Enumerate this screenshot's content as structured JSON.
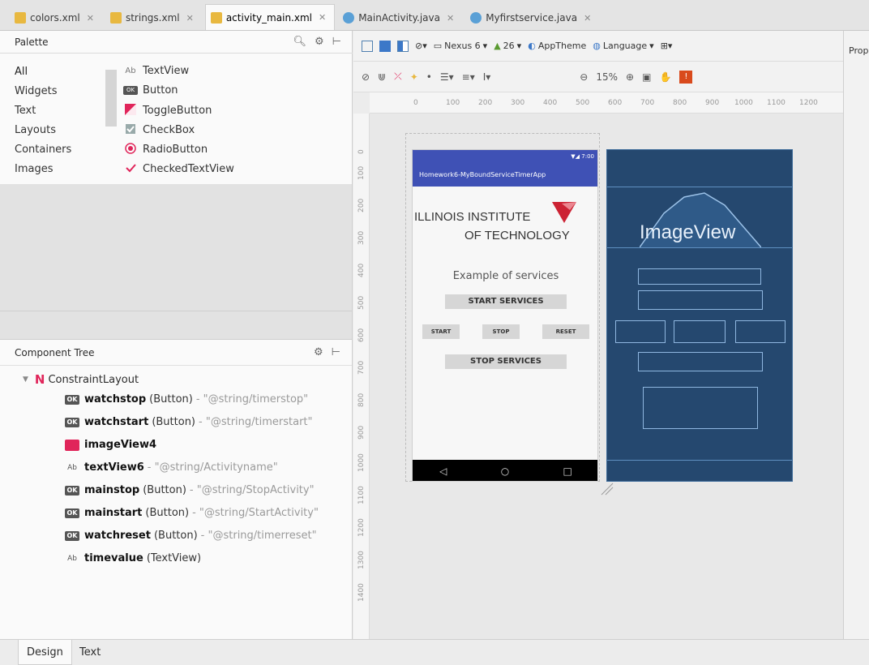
{
  "tabs": [
    {
      "label": "colors.xml",
      "kind": "xml",
      "active": false
    },
    {
      "label": "strings.xml",
      "kind": "xml",
      "active": false
    },
    {
      "label": "activity_main.xml",
      "kind": "xml",
      "active": true
    },
    {
      "label": "MainActivity.java",
      "kind": "java",
      "active": false
    },
    {
      "label": "Myfirstservice.java",
      "kind": "java",
      "active": false
    }
  ],
  "palette": {
    "title": "Palette",
    "categories": [
      "All",
      "Widgets",
      "Text",
      "Layouts",
      "Containers",
      "Images"
    ],
    "items": [
      {
        "icon": "Ab",
        "label": "TextView"
      },
      {
        "icon": "OK",
        "label": "Button"
      },
      {
        "icon": "toggle-icon",
        "label": "ToggleButton"
      },
      {
        "icon": "checkbox-icon",
        "label": "CheckBox"
      },
      {
        "icon": "radio-icon",
        "label": "RadioButton"
      },
      {
        "icon": "check-icon",
        "label": "CheckedTextView"
      }
    ]
  },
  "tree": {
    "title": "Component Tree",
    "root": "ConstraintLayout",
    "items": [
      {
        "icon": "OK",
        "name": "watchstop",
        "type": "(Button)",
        "str": "- \"@string/timerstop\""
      },
      {
        "icon": "OK",
        "name": "watchstart",
        "type": "(Button)",
        "str": "- \"@string/timerstart\""
      },
      {
        "icon": "image",
        "name": "imageView4",
        "type": "",
        "str": ""
      },
      {
        "icon": "Ab",
        "name": "textView6",
        "type": "",
        "str": "- \"@string/Activityname\""
      },
      {
        "icon": "OK",
        "name": "mainstop",
        "type": "(Button)",
        "str": "- \"@string/StopActivity\""
      },
      {
        "icon": "OK",
        "name": "mainstart",
        "type": "(Button)",
        "str": "- \"@string/StartActivity\""
      },
      {
        "icon": "OK",
        "name": "watchreset",
        "type": "(Button)",
        "str": "- \"@string/timerreset\""
      },
      {
        "icon": "Ab",
        "name": "timevalue",
        "type": "(TextView)",
        "str": ""
      }
    ]
  },
  "toolbar": {
    "device": "Nexus 6",
    "api": "26",
    "theme": "AppTheme",
    "language": "Language",
    "zoom": "15%"
  },
  "properties_label": "Prop",
  "ruler": {
    "h_ticks": [
      "0",
      "100",
      "200",
      "300",
      "400",
      "500",
      "600",
      "700",
      "800",
      "900",
      "1000",
      "1100",
      "1200"
    ],
    "v_ticks": [
      "0",
      "100",
      "200",
      "300",
      "400",
      "500",
      "600",
      "700",
      "800",
      "900",
      "1000",
      "1100",
      "1200",
      "1300",
      "1400"
    ]
  },
  "phone": {
    "status": "▼◢ 7:00",
    "app_title": "Homework6-MyBoundServiceTimerApp",
    "logo_line1": "ILLINOIS INSTITUTE",
    "logo_line2": "OF TECHNOLOGY",
    "example_text": "Example of services",
    "start_services": "START SERVICES",
    "start": "START",
    "stop": "STOP",
    "reset": "RESET",
    "stop_services": "STOP SERVICES",
    "nav_back": "◁",
    "nav_home": "○",
    "nav_recent": "□"
  },
  "blueprint": {
    "image_label": "ImageView"
  },
  "bottom_tabs": [
    {
      "label": "Design",
      "active": true
    },
    {
      "label": "Text",
      "active": false
    }
  ],
  "colors": {
    "app_bar": "#3f51b5",
    "blueprint_bg": "#25486f",
    "blueprint_line": "#8fb7e0",
    "iit_red": "#cc2233"
  }
}
